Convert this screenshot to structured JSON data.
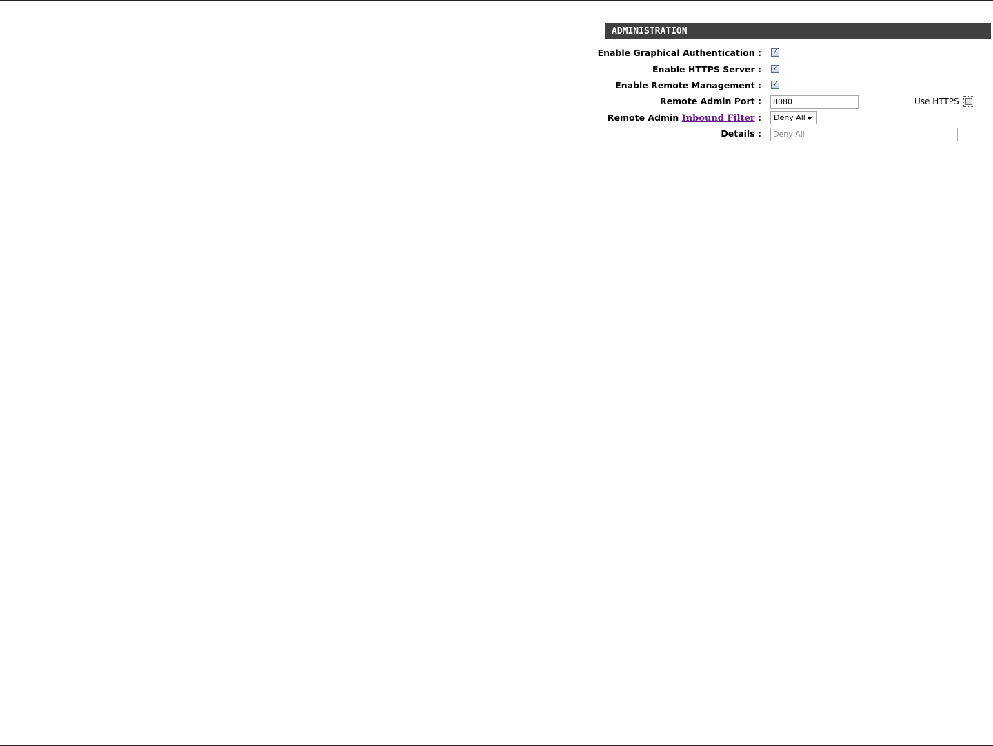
{
  "section": {
    "title": "ADMINISTRATION"
  },
  "fields": {
    "graphical_auth": {
      "label": "Enable Graphical Authentication :",
      "checked": true
    },
    "https_server": {
      "label": "Enable HTTPS Server :",
      "checked": true
    },
    "remote_mgmt": {
      "label": "Enable Remote Management :",
      "checked": true
    },
    "remote_port": {
      "label": "Remote Admin Port :",
      "value": "8080"
    },
    "use_https": {
      "label": "Use HTTPS",
      "checked": false
    },
    "inbound_filter": {
      "label_prefix": "Remote Admin ",
      "link_text": "Inbound Filter",
      "label_suffix": " :",
      "selected": "Deny All"
    },
    "details": {
      "label": "Details :",
      "value": "Deny All"
    }
  },
  "icons": {
    "checkmark": "check-icon",
    "dropdown": "chevron-down-icon"
  },
  "colors": {
    "header_bg": "#404040",
    "link": "#6a1b8e"
  }
}
